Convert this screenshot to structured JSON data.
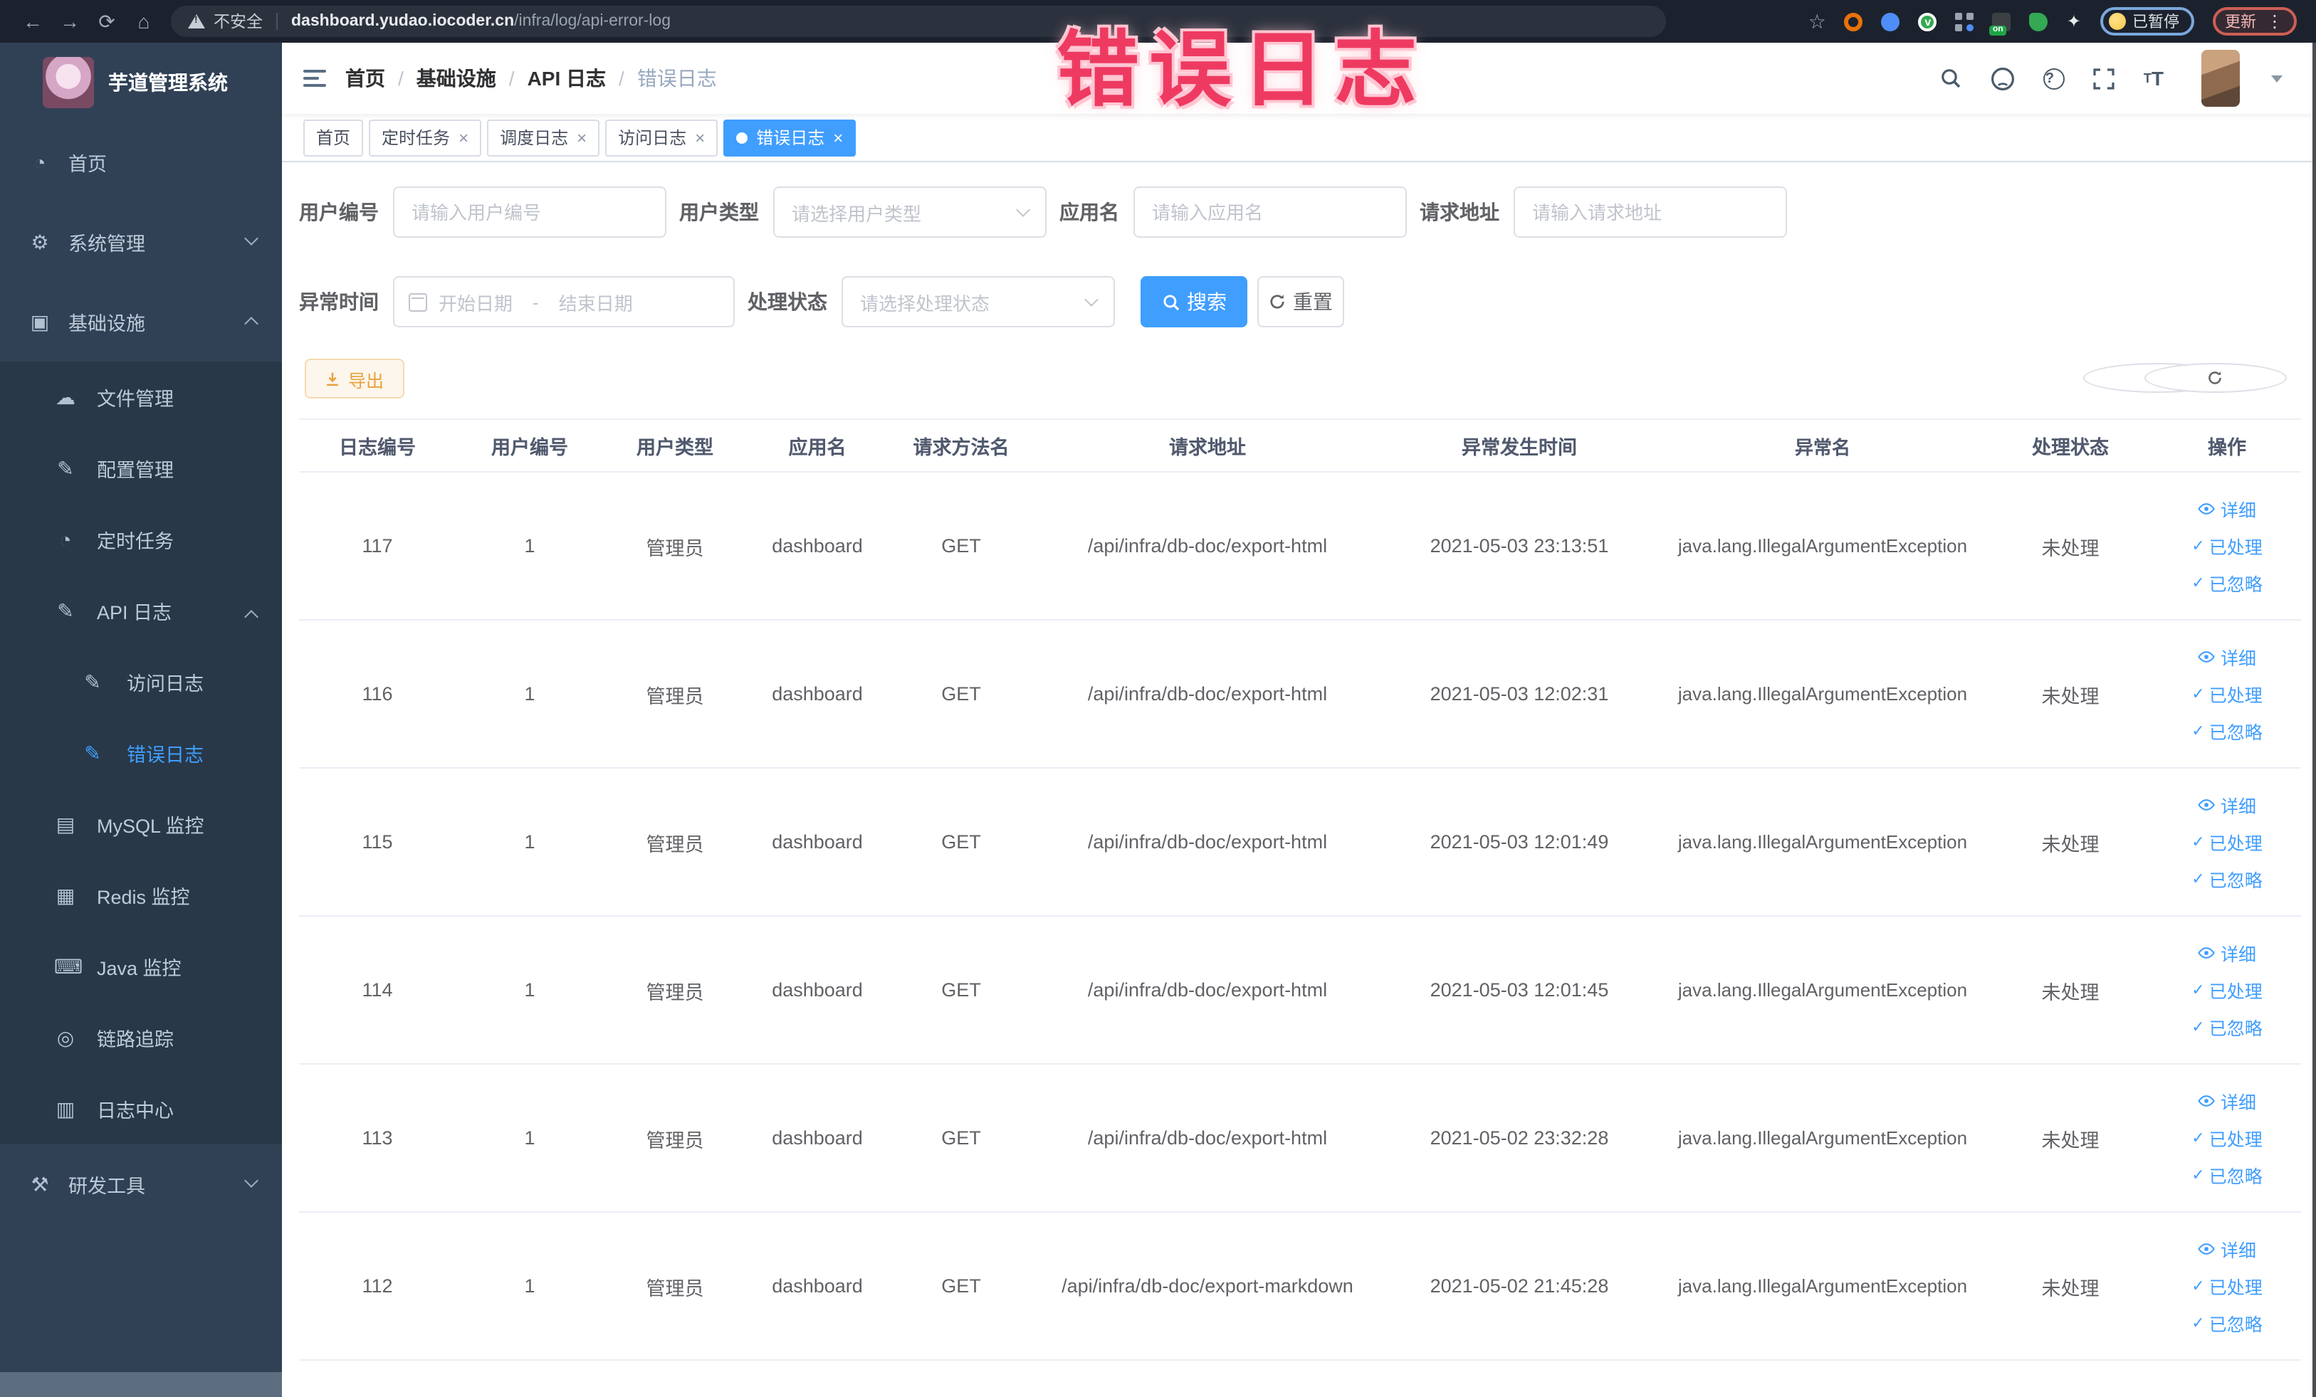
{
  "browser": {
    "security": "不安全",
    "host": "dashboard.yudao.iocoder.cn",
    "path": "/infra/log/api-error-log",
    "on_badge": "on",
    "pill_paused": "已暂停",
    "pill_update": "更新"
  },
  "overlay_title": "错误日志",
  "sidebar": {
    "title": "芋道管理系统",
    "menu": {
      "home": "首页",
      "system": "系统管理",
      "infra": "基础设施",
      "file": "文件管理",
      "config": "配置管理",
      "job": "定时任务",
      "api_log": "API 日志",
      "access_log": "访问日志",
      "error_log": "错误日志",
      "mysql": "MySQL 监控",
      "redis": "Redis 监控",
      "java": "Java 监控",
      "trace": "链路追踪",
      "log_center": "日志中心",
      "dev_tools": "研发工具"
    }
  },
  "breadcrumb": [
    "首页",
    "基础设施",
    "API 日志",
    "错误日志"
  ],
  "tabs": [
    {
      "label": "首页"
    },
    {
      "label": "定时任务"
    },
    {
      "label": "调度日志"
    },
    {
      "label": "访问日志"
    },
    {
      "label": "错误日志"
    }
  ],
  "filters": {
    "user_id": {
      "label": "用户编号",
      "placeholder": "请输入用户编号"
    },
    "user_type": {
      "label": "用户类型",
      "placeholder": "请选择用户类型"
    },
    "app_name": {
      "label": "应用名",
      "placeholder": "请输入应用名"
    },
    "request_url": {
      "label": "请求地址",
      "placeholder": "请输入请求地址"
    },
    "exception_time": {
      "label": "异常时间",
      "start_placeholder": "开始日期",
      "separator": "-",
      "end_placeholder": "结束日期"
    },
    "process_status": {
      "label": "处理状态",
      "placeholder": "请选择处理状态"
    },
    "search_label": "搜索",
    "reset_label": "重置"
  },
  "toolbar": {
    "export_label": "导出"
  },
  "table": {
    "headers": [
      "日志编号",
      "用户编号",
      "用户类型",
      "应用名",
      "请求方法名",
      "请求地址",
      "异常发生时间",
      "异常名",
      "处理状态",
      "操作"
    ],
    "actions": {
      "detail": "详细",
      "processed": "已处理",
      "ignored": "已忽略"
    },
    "rows": [
      {
        "id": "117",
        "user_id": "1",
        "user_type": "管理员",
        "app": "dashboard",
        "method": "GET",
        "url": "/api/infra/db-doc/export-html",
        "time": "2021-05-03 23:13:51",
        "exception": "java.lang.IllegalArgumentException",
        "status": "未处理"
      },
      {
        "id": "116",
        "user_id": "1",
        "user_type": "管理员",
        "app": "dashboard",
        "method": "GET",
        "url": "/api/infra/db-doc/export-html",
        "time": "2021-05-03 12:02:31",
        "exception": "java.lang.IllegalArgumentException",
        "status": "未处理"
      },
      {
        "id": "115",
        "user_id": "1",
        "user_type": "管理员",
        "app": "dashboard",
        "method": "GET",
        "url": "/api/infra/db-doc/export-html",
        "time": "2021-05-03 12:01:49",
        "exception": "java.lang.IllegalArgumentException",
        "status": "未处理"
      },
      {
        "id": "114",
        "user_id": "1",
        "user_type": "管理员",
        "app": "dashboard",
        "method": "GET",
        "url": "/api/infra/db-doc/export-html",
        "time": "2021-05-03 12:01:45",
        "exception": "java.lang.IllegalArgumentException",
        "status": "未处理"
      },
      {
        "id": "113",
        "user_id": "1",
        "user_type": "管理员",
        "app": "dashboard",
        "method": "GET",
        "url": "/api/infra/db-doc/export-html",
        "time": "2021-05-02 23:32:28",
        "exception": "java.lang.IllegalArgumentException",
        "status": "未处理"
      },
      {
        "id": "112",
        "user_id": "1",
        "user_type": "管理员",
        "app": "dashboard",
        "method": "GET",
        "url": "/api/infra/db-doc/export-markdown",
        "time": "2021-05-02 21:45:28",
        "exception": "java.lang.IllegalArgumentException",
        "status": "未处理"
      }
    ]
  }
}
